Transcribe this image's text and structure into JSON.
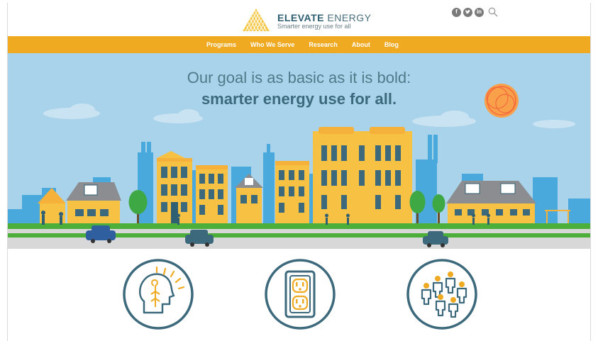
{
  "header": {
    "brand_bold": "ELEVATE",
    "brand_light": "ENERGY",
    "tagline": "Smarter energy use for all",
    "social": [
      {
        "icon": "facebook-icon",
        "glyph": "f"
      },
      {
        "icon": "twitter-icon",
        "glyph": "t"
      },
      {
        "icon": "linkedin-icon",
        "glyph": "in"
      }
    ],
    "search_icon": "search-icon"
  },
  "nav": {
    "items": [
      {
        "label": "Programs"
      },
      {
        "label": "Who We Serve"
      },
      {
        "label": "Research"
      },
      {
        "label": "About"
      },
      {
        "label": "Blog"
      }
    ]
  },
  "hero": {
    "line1": "Our goal is as basic as it is bold:",
    "line2": "smarter energy use for all."
  },
  "features": [
    {
      "icon": "head-idea-icon"
    },
    {
      "icon": "power-outlet-icon"
    },
    {
      "icon": "people-community-icon"
    }
  ],
  "colors": {
    "accent": "#efaa22",
    "sky": "#a9d3ea",
    "brand_teal": "#2f5f73",
    "building_yellow": "#f7c244",
    "road": "#d8d8d8",
    "grass": "#4caf3a"
  }
}
